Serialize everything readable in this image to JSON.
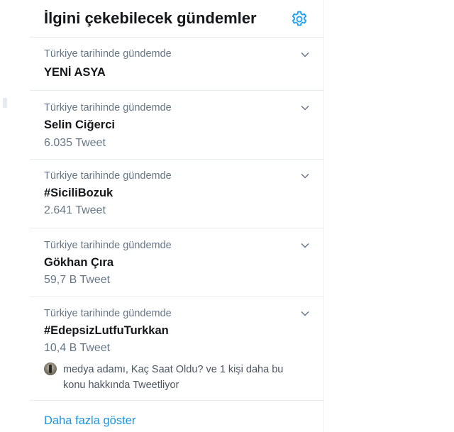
{
  "header": {
    "title": "İlgini çekebilecek gündemler",
    "settings_icon": "gear-icon",
    "accent_color": "#1da1f2"
  },
  "trends": [
    {
      "context": "Türkiye tarihinde gündemde",
      "name": "YENİ ASYA",
      "count": ""
    },
    {
      "context": "Türkiye tarihinde gündemde",
      "name": "Selin Ciğerci",
      "count": "6.035 Tweet"
    },
    {
      "context": "Türkiye tarihinde gündemde",
      "name": "#SiciliBozuk",
      "count": "2.641 Tweet"
    },
    {
      "context": "Türkiye tarihinde gündemde",
      "name": "Gökhan Çıra",
      "count": "59,7 B Tweet"
    },
    {
      "context": "Türkiye tarihinde gündemde",
      "name": "#EdepsizLutfuTurkkan",
      "count": "10,4 B Tweet",
      "related": {
        "line1": "medya adamı, Kaç Saat Oldu? ve 1 kişi daha bu",
        "line2": "konu hakkında Tweetliyor"
      }
    }
  ],
  "show_more": "Daha fazla göster",
  "link_color": "#1b95e0"
}
